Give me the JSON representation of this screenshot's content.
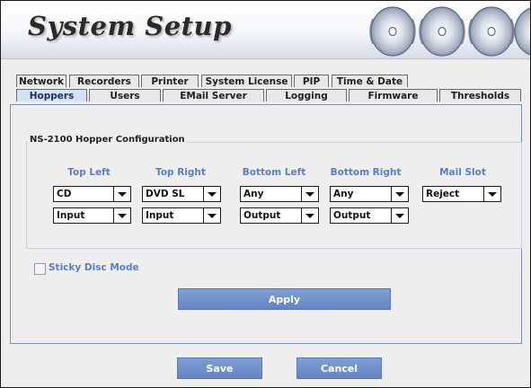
{
  "header": {
    "title": "System Setup"
  },
  "tabs": {
    "row1": [
      {
        "label": "Network"
      },
      {
        "label": "Recorders"
      },
      {
        "label": "Printer"
      },
      {
        "label": "System License"
      },
      {
        "label": "PIP"
      },
      {
        "label": "Time & Date"
      }
    ],
    "row2": [
      {
        "label": "Hoppers",
        "active": true
      },
      {
        "label": "Users"
      },
      {
        "label": "EMail Server"
      },
      {
        "label": "Logging"
      },
      {
        "label": "Firmware"
      },
      {
        "label": "Thresholds"
      }
    ]
  },
  "panel": {
    "group_title": "NS-2100 Hopper Configuration",
    "columns": [
      {
        "label": "Top Left",
        "media": "CD",
        "direction": "Input"
      },
      {
        "label": "Top Right",
        "media": "DVD SL",
        "direction": "Input"
      },
      {
        "label": "Bottom Left",
        "media": "Any",
        "direction": "Output"
      },
      {
        "label": "Bottom Right",
        "media": "Any",
        "direction": "Output"
      },
      {
        "label": "Mail Slot",
        "media": "Reject"
      }
    ],
    "sticky_disc_mode": {
      "label": "Sticky Disc Mode",
      "checked": false
    },
    "apply_label": "Apply"
  },
  "footer": {
    "save_label": "Save",
    "cancel_label": "Cancel"
  },
  "colors": {
    "accent": "#6a89c8",
    "label": "#5a7ec5",
    "frame": "#1a1a1a"
  }
}
